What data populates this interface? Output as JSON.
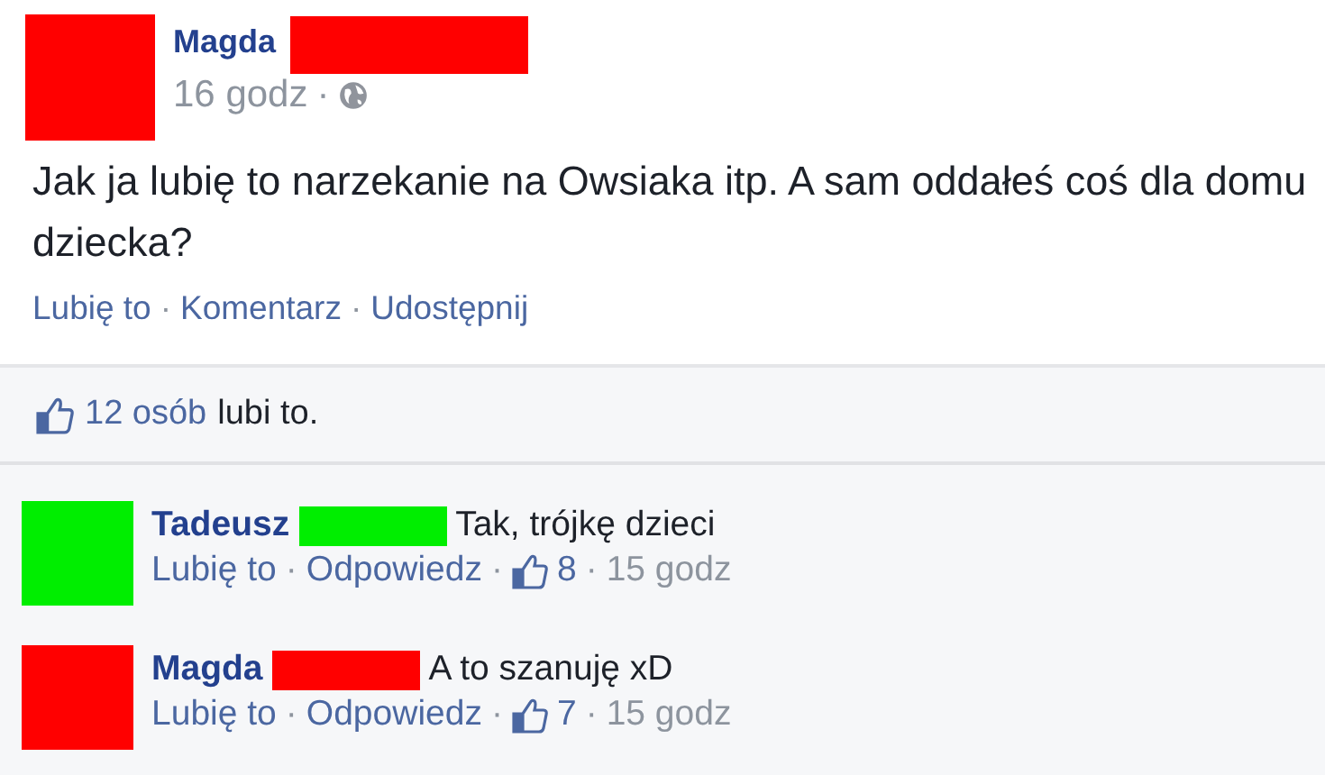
{
  "post": {
    "author": "Magda",
    "color": "#ff0000",
    "time": "16 godz",
    "separator": "·",
    "text": "Jak ja lubię to narzekanie na Owsiaka itp. A sam oddałeś coś dla domu dziecka?",
    "actions": [
      "Lubię to",
      "Komentarz",
      "Udostępnij"
    ]
  },
  "likes": {
    "count": "12 osób",
    "suffix": "lubi to."
  },
  "comments": [
    {
      "author": "Tadeusz",
      "color": "#00ee00",
      "text": "Tak, trójkę dzieci",
      "actions": [
        "Lubię to",
        "Odpowiedz"
      ],
      "likes": "8",
      "time": "15 godz"
    },
    {
      "author": "Magda",
      "color": "#ff0000",
      "text": "A to szanuję xD",
      "actions": [
        "Lubię to",
        "Odpowiedz"
      ],
      "likes": "7",
      "time": "15 godz"
    }
  ]
}
